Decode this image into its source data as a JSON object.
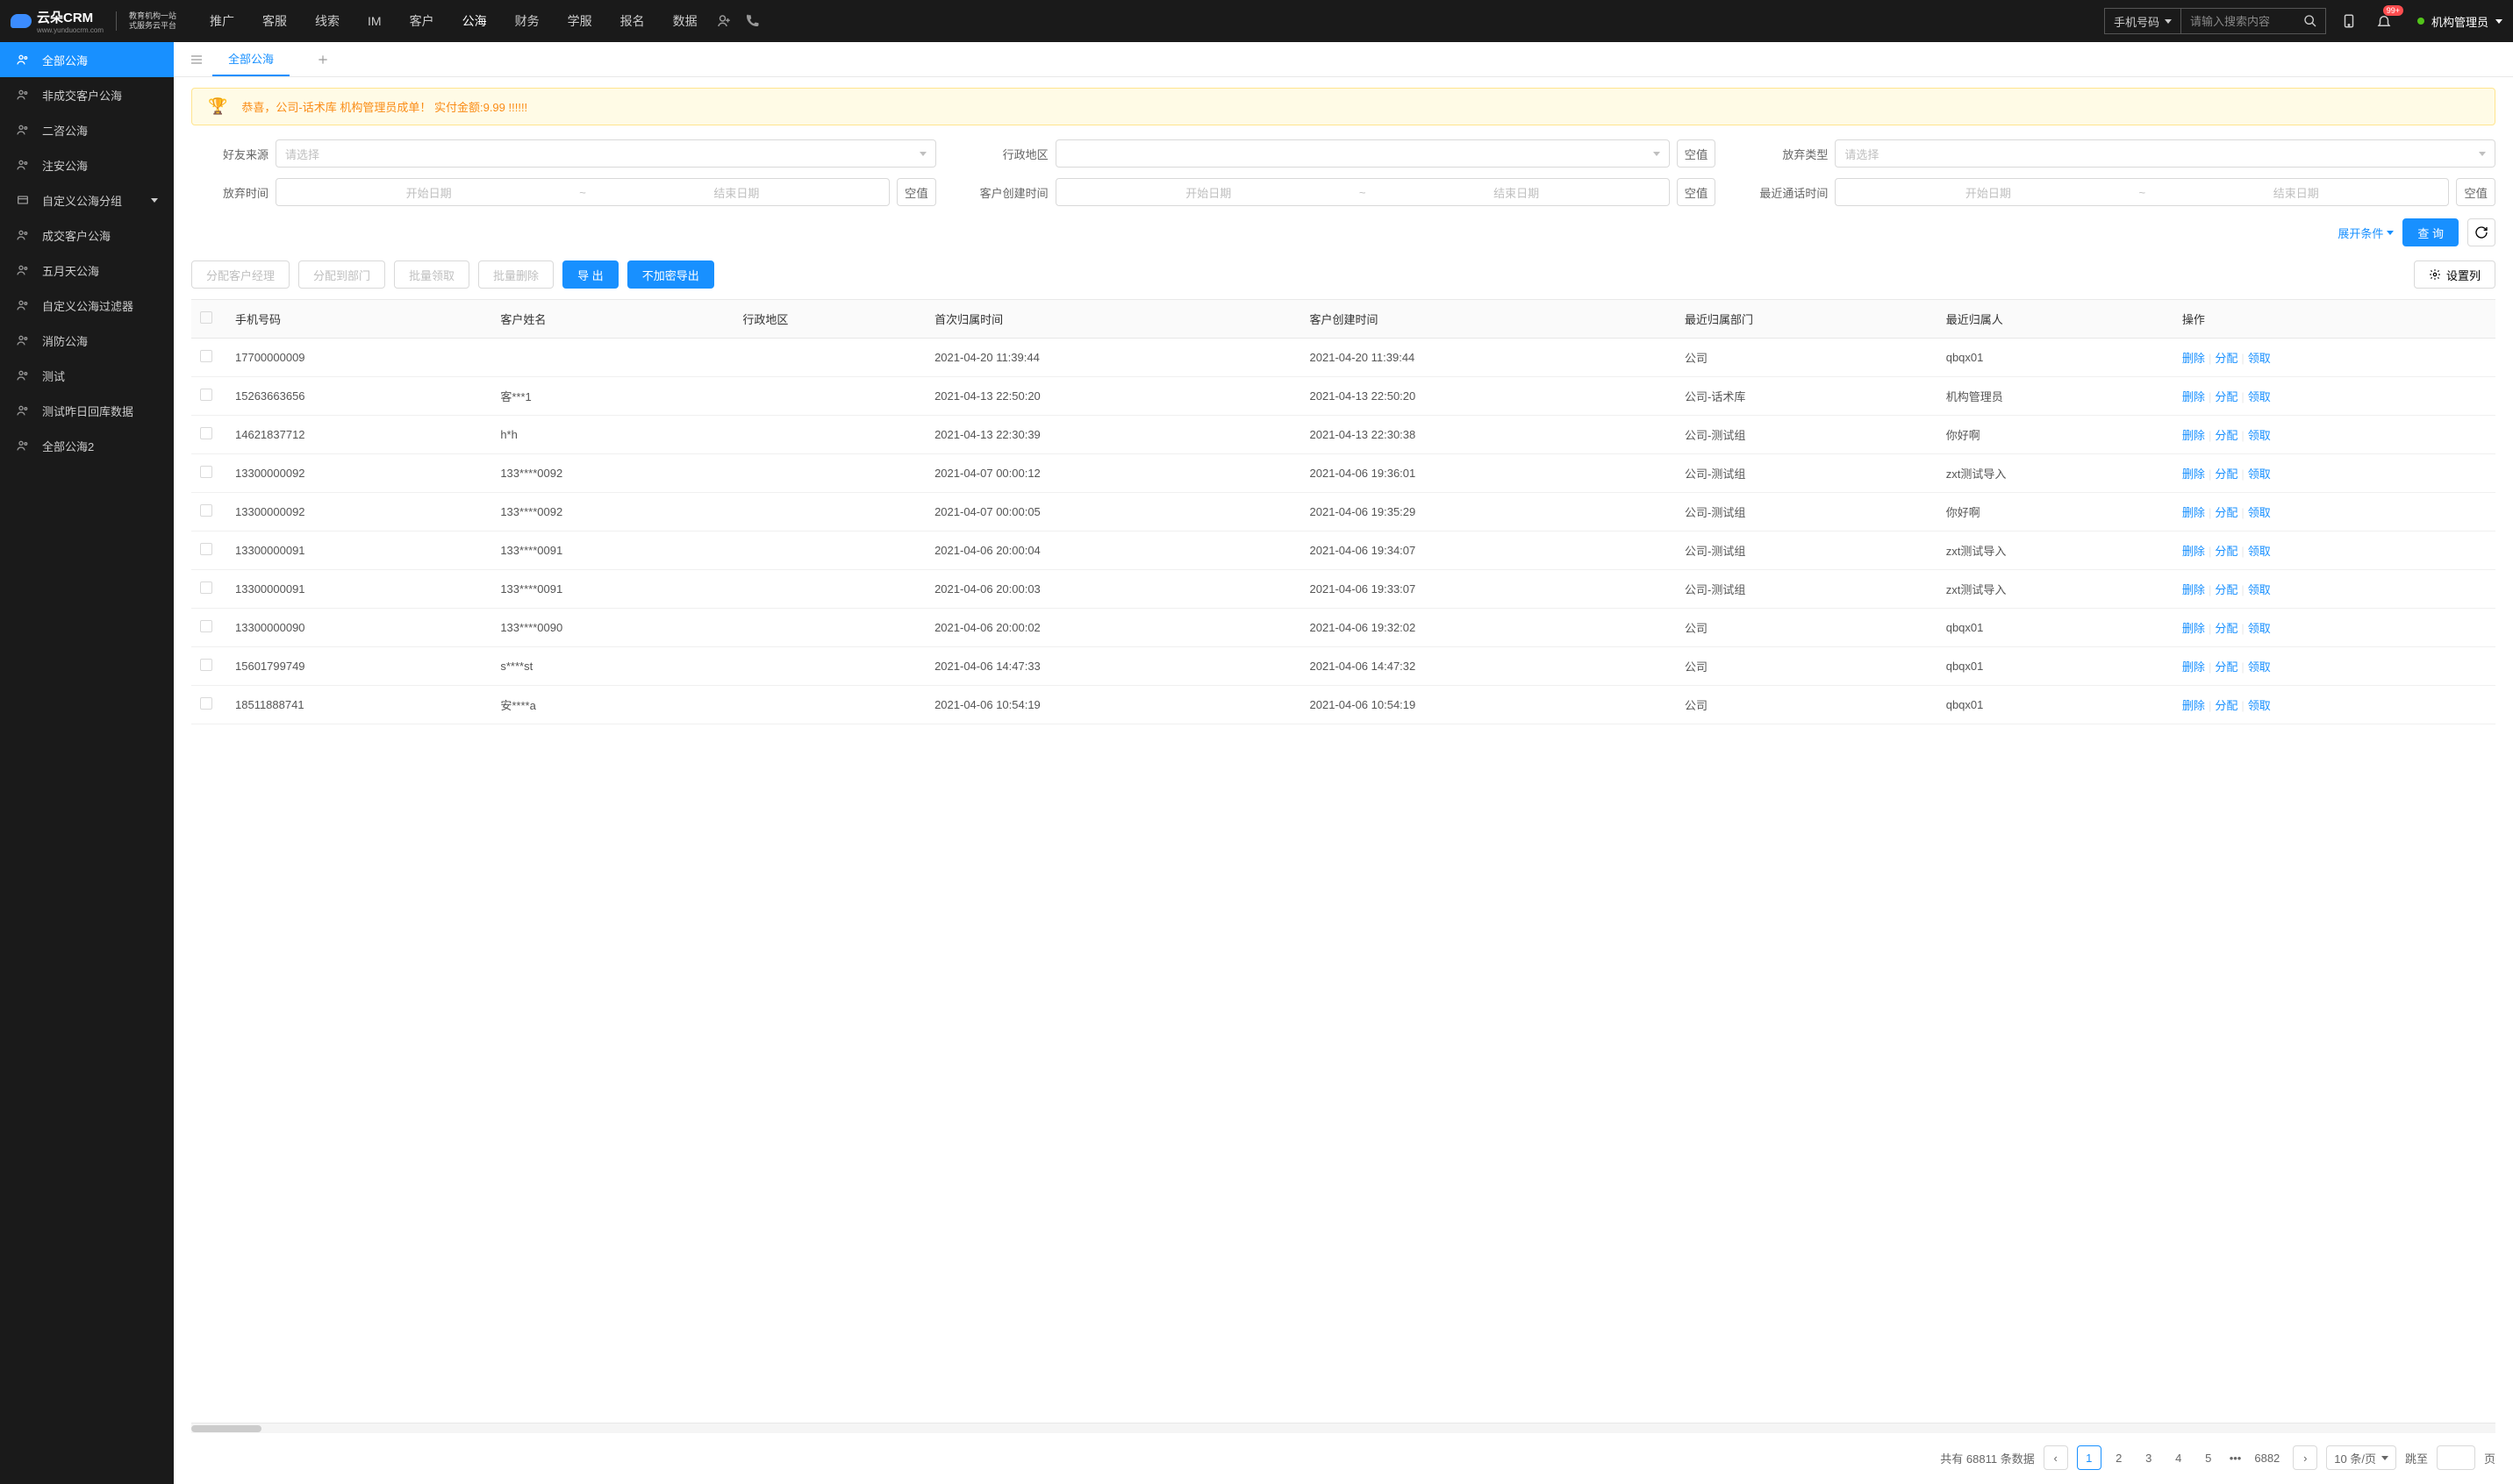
{
  "header": {
    "logo_main": "云朵CRM",
    "logo_url": "www.yunduocrm.com",
    "logo_sub1": "教育机构一站",
    "logo_sub2": "式服务云平台",
    "nav": [
      "推广",
      "客服",
      "线索",
      "IM",
      "客户",
      "公海",
      "财务",
      "学服",
      "报名",
      "数据"
    ],
    "nav_active": 5,
    "search_type": "手机号码",
    "search_placeholder": "请输入搜索内容",
    "notif_badge": "99+",
    "user_name": "机构管理员"
  },
  "sidebar": {
    "items": [
      {
        "label": "全部公海",
        "icon": "users"
      },
      {
        "label": "非成交客户公海",
        "icon": "users"
      },
      {
        "label": "二咨公海",
        "icon": "users"
      },
      {
        "label": "注安公海",
        "icon": "users"
      },
      {
        "label": "自定义公海分组",
        "icon": "folder",
        "expandable": true
      },
      {
        "label": "成交客户公海",
        "icon": "users"
      },
      {
        "label": "五月天公海",
        "icon": "users"
      },
      {
        "label": "自定义公海过滤器",
        "icon": "users"
      },
      {
        "label": "消防公海",
        "icon": "users"
      },
      {
        "label": "测试",
        "icon": "users"
      },
      {
        "label": "测试昨日回库数据",
        "icon": "users"
      },
      {
        "label": "全部公海2",
        "icon": "users"
      }
    ],
    "active": 0
  },
  "tabs": {
    "items": [
      "全部公海"
    ],
    "active": 0
  },
  "banner": "恭喜，公司-话术库 机构管理员成单！ 实付金额:9.99 !!!!!!",
  "filters": {
    "f1_label": "好友来源",
    "f1_placeholder": "请选择",
    "f2_label": "行政地区",
    "f3_label": "放弃类型",
    "f3_placeholder": "请选择",
    "f4_label": "放弃时间",
    "f5_label": "客户创建时间",
    "f6_label": "最近通话时间",
    "date_start": "开始日期",
    "date_end": "结束日期",
    "null_btn": "空值",
    "expand": "展开条件",
    "query": "查 询"
  },
  "toolbar": {
    "b1": "分配客户经理",
    "b2": "分配到部门",
    "b3": "批量领取",
    "b4": "批量删除",
    "b5": "导 出",
    "b6": "不加密导出",
    "b7": "设置列"
  },
  "table": {
    "headers": [
      "手机号码",
      "客户姓名",
      "行政地区",
      "首次归属时间",
      "客户创建时间",
      "最近归属部门",
      "最近归属人",
      "操作"
    ],
    "actions": {
      "delete": "删除",
      "assign": "分配",
      "claim": "领取"
    },
    "rows": [
      {
        "phone": "17700000009",
        "name": "",
        "region": "",
        "first_time": "2021-04-20 11:39:44",
        "create_time": "2021-04-20 11:39:44",
        "dept": "公司",
        "owner": "qbqx01"
      },
      {
        "phone": "15263663656",
        "name": "客***1",
        "region": "",
        "first_time": "2021-04-13 22:50:20",
        "create_time": "2021-04-13 22:50:20",
        "dept": "公司-话术库",
        "owner": "机构管理员"
      },
      {
        "phone": "14621837712",
        "name": "h*h",
        "region": "",
        "first_time": "2021-04-13 22:30:39",
        "create_time": "2021-04-13 22:30:38",
        "dept": "公司-测试组",
        "owner": "你好啊"
      },
      {
        "phone": "13300000092",
        "name": "133****0092",
        "region": "",
        "first_time": "2021-04-07 00:00:12",
        "create_time": "2021-04-06 19:36:01",
        "dept": "公司-测试组",
        "owner": "zxt测试导入"
      },
      {
        "phone": "13300000092",
        "name": "133****0092",
        "region": "",
        "first_time": "2021-04-07 00:00:05",
        "create_time": "2021-04-06 19:35:29",
        "dept": "公司-测试组",
        "owner": "你好啊"
      },
      {
        "phone": "13300000091",
        "name": "133****0091",
        "region": "",
        "first_time": "2021-04-06 20:00:04",
        "create_time": "2021-04-06 19:34:07",
        "dept": "公司-测试组",
        "owner": "zxt测试导入"
      },
      {
        "phone": "13300000091",
        "name": "133****0091",
        "region": "",
        "first_time": "2021-04-06 20:00:03",
        "create_time": "2021-04-06 19:33:07",
        "dept": "公司-测试组",
        "owner": "zxt测试导入"
      },
      {
        "phone": "13300000090",
        "name": "133****0090",
        "region": "",
        "first_time": "2021-04-06 20:00:02",
        "create_time": "2021-04-06 19:32:02",
        "dept": "公司",
        "owner": "qbqx01"
      },
      {
        "phone": "15601799749",
        "name": "s****st",
        "region": "",
        "first_time": "2021-04-06 14:47:33",
        "create_time": "2021-04-06 14:47:32",
        "dept": "公司",
        "owner": "qbqx01"
      },
      {
        "phone": "18511888741",
        "name": "安****a",
        "region": "",
        "first_time": "2021-04-06 10:54:19",
        "create_time": "2021-04-06 10:54:19",
        "dept": "公司",
        "owner": "qbqx01"
      }
    ]
  },
  "pagination": {
    "total_prefix": "共有",
    "total": "68811",
    "total_suffix": "条数据",
    "pages": [
      "1",
      "2",
      "3",
      "4",
      "5"
    ],
    "last_page": "6882",
    "page_size": "10 条/页",
    "jump_label": "跳至",
    "jump_suffix": "页"
  }
}
